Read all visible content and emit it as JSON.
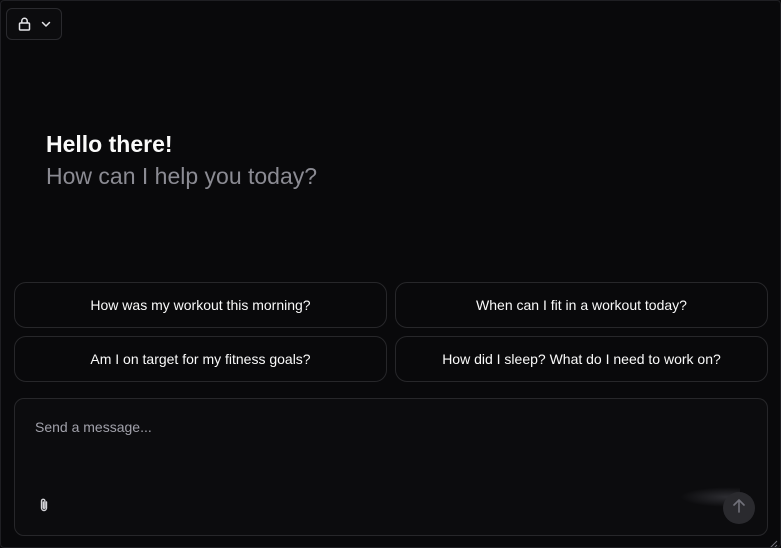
{
  "header": {
    "selector_icon": "lock-icon",
    "selector_chevron": "chevron-down-icon"
  },
  "greeting": {
    "title": "Hello there!",
    "subtitle": "How can I help you today?"
  },
  "suggestions": [
    "How was my workout this morning?",
    "When can I fit in a workout today?",
    "Am I on target for my fitness goals?",
    "How did I sleep? What do I need to work on?"
  ],
  "composer": {
    "placeholder": "Send a message...",
    "value": "",
    "attach_icon": "paperclip-icon",
    "send_icon": "arrow-up-icon"
  },
  "colors": {
    "background": "#09090b",
    "border": "#27272a",
    "muted_text": "#8b8b93"
  }
}
